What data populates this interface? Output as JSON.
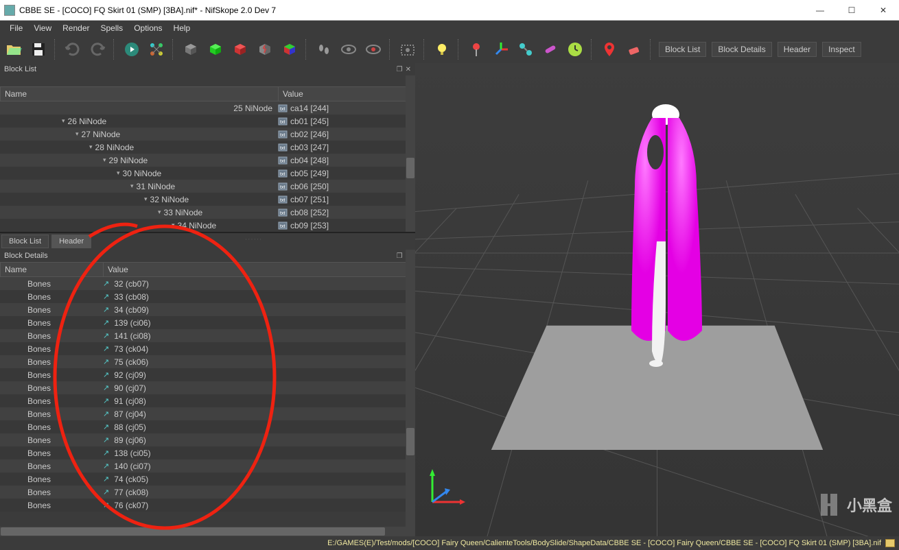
{
  "window": {
    "title": "CBBE SE - [COCO] FQ Skirt 01 (SMP) [3BA].nif* - NifSkope 2.0 Dev 7"
  },
  "menubar": [
    "File",
    "View",
    "Render",
    "Spells",
    "Options",
    "Help"
  ],
  "toolbar_text_buttons": [
    "Block List",
    "Block Details",
    "Header",
    "Inspect"
  ],
  "blocklist": {
    "title": "Block List",
    "columns": {
      "name": "Name",
      "value": "Value"
    },
    "rows": [
      {
        "indent": 70,
        "arrow": "",
        "label": "25 NiNode",
        "value": "ca14 [244]",
        "labelRight": true
      },
      {
        "indent": 90,
        "arrow": "▾",
        "label": "26 NiNode",
        "value": "cb01 [245]"
      },
      {
        "indent": 110,
        "arrow": "▾",
        "label": "27 NiNode",
        "value": "cb02 [246]"
      },
      {
        "indent": 130,
        "arrow": "▾",
        "label": "28 NiNode",
        "value": "cb03 [247]"
      },
      {
        "indent": 150,
        "arrow": "▾",
        "label": "29 NiNode",
        "value": "cb04 [248]"
      },
      {
        "indent": 170,
        "arrow": "▾",
        "label": "30 NiNode",
        "value": "cb05 [249]"
      },
      {
        "indent": 190,
        "arrow": "▾",
        "label": "31 NiNode",
        "value": "cb06 [250]"
      },
      {
        "indent": 210,
        "arrow": "▾",
        "label": "32 NiNode",
        "value": "cb07 [251]"
      },
      {
        "indent": 230,
        "arrow": "▾",
        "label": "33 NiNode",
        "value": "cb08 [252]"
      },
      {
        "indent": 250,
        "arrow": "▾",
        "label": "34 NiNode",
        "value": "cb09 [253]"
      }
    ]
  },
  "tabs": [
    {
      "label": "Block List",
      "active": false
    },
    {
      "label": "Header",
      "active": true
    }
  ],
  "details": {
    "title": "Block Details",
    "columns": {
      "name": "Name",
      "value": "Value"
    },
    "rows": [
      {
        "name": "Bones",
        "value": "32 (cb07)"
      },
      {
        "name": "Bones",
        "value": "33 (cb08)"
      },
      {
        "name": "Bones",
        "value": "34 (cb09)"
      },
      {
        "name": "Bones",
        "value": "139 (ci06)"
      },
      {
        "name": "Bones",
        "value": "141 (ci08)"
      },
      {
        "name": "Bones",
        "value": "73 (ck04)"
      },
      {
        "name": "Bones",
        "value": "75 (ck06)"
      },
      {
        "name": "Bones",
        "value": "92 (cj09)"
      },
      {
        "name": "Bones",
        "value": "90 (cj07)"
      },
      {
        "name": "Bones",
        "value": "91 (cj08)"
      },
      {
        "name": "Bones",
        "value": "87 (cj04)"
      },
      {
        "name": "Bones",
        "value": "88 (cj05)"
      },
      {
        "name": "Bones",
        "value": "89 (cj06)"
      },
      {
        "name": "Bones",
        "value": "138 (ci05)"
      },
      {
        "name": "Bones",
        "value": "140 (ci07)"
      },
      {
        "name": "Bones",
        "value": "74 (ck05)"
      },
      {
        "name": "Bones",
        "value": "77 (ck08)"
      },
      {
        "name": "Bones",
        "value": "76 (ck07)"
      }
    ]
  },
  "statusbar": {
    "path": "E:/GAMES(E)/Test/mods/[COCO] Fairy Queen/CalienteTools/BodySlide/ShapeData/CBBE SE - [COCO] Fairy Queen/CBBE SE - [COCO] FQ Skirt 01 (SMP) [3BA].nif"
  },
  "watermark": "小黑盒"
}
